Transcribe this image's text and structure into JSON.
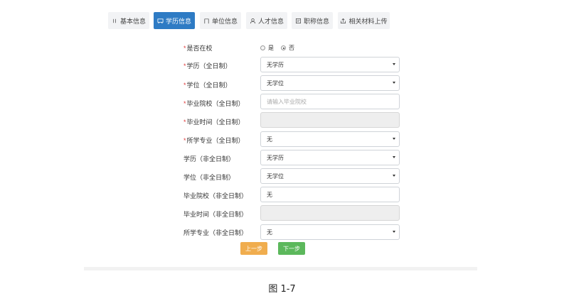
{
  "tabs": [
    {
      "label": "基本信息",
      "icon": "bars-icon"
    },
    {
      "label": "学历信息",
      "icon": "graduation-cap-icon",
      "active": true
    },
    {
      "label": "单位信息",
      "icon": "building-icon"
    },
    {
      "label": "人才信息",
      "icon": "user-icon"
    },
    {
      "label": "职称信息",
      "icon": "certificate-icon"
    },
    {
      "label": "相关材料上传",
      "icon": "upload-icon"
    }
  ],
  "form": {
    "in_school": {
      "label": "是否在校",
      "required": true,
      "options": [
        "是",
        "否"
      ],
      "selected": "否"
    },
    "fields": [
      {
        "label": "学历（全日制）",
        "required": true,
        "type": "select",
        "value": "无学历"
      },
      {
        "label": "学位（全日制）",
        "required": true,
        "type": "select",
        "value": "无学位"
      },
      {
        "label": "毕业院校（全日制）",
        "required": true,
        "type": "input",
        "value": "",
        "placeholder": "请输入毕业院校"
      },
      {
        "label": "毕业时间（全日制）",
        "required": true,
        "type": "disabled",
        "value": ""
      },
      {
        "label": "所学专业（全日制）",
        "required": true,
        "type": "select",
        "value": "无"
      },
      {
        "label": "学历（非全日制）",
        "required": false,
        "type": "select",
        "value": "无学历"
      },
      {
        "label": "学位（非全日制）",
        "required": false,
        "type": "select",
        "value": "无学位"
      },
      {
        "label": "毕业院校（非全日制）",
        "required": false,
        "type": "input",
        "value": "无",
        "placeholder": ""
      },
      {
        "label": "毕业时间（非全日制）",
        "required": false,
        "type": "disabled",
        "value": ""
      },
      {
        "label": "所学专业（非全日制）",
        "required": false,
        "type": "select",
        "value": "无"
      }
    ]
  },
  "buttons": {
    "prev": "上一步",
    "next": "下一步"
  },
  "colors": {
    "active_tab": "#2e7bc4",
    "prev_button": "#f0ad4e",
    "next_button": "#5cb85c",
    "required_mark": "#e23b3b"
  },
  "caption": "图 1-7"
}
